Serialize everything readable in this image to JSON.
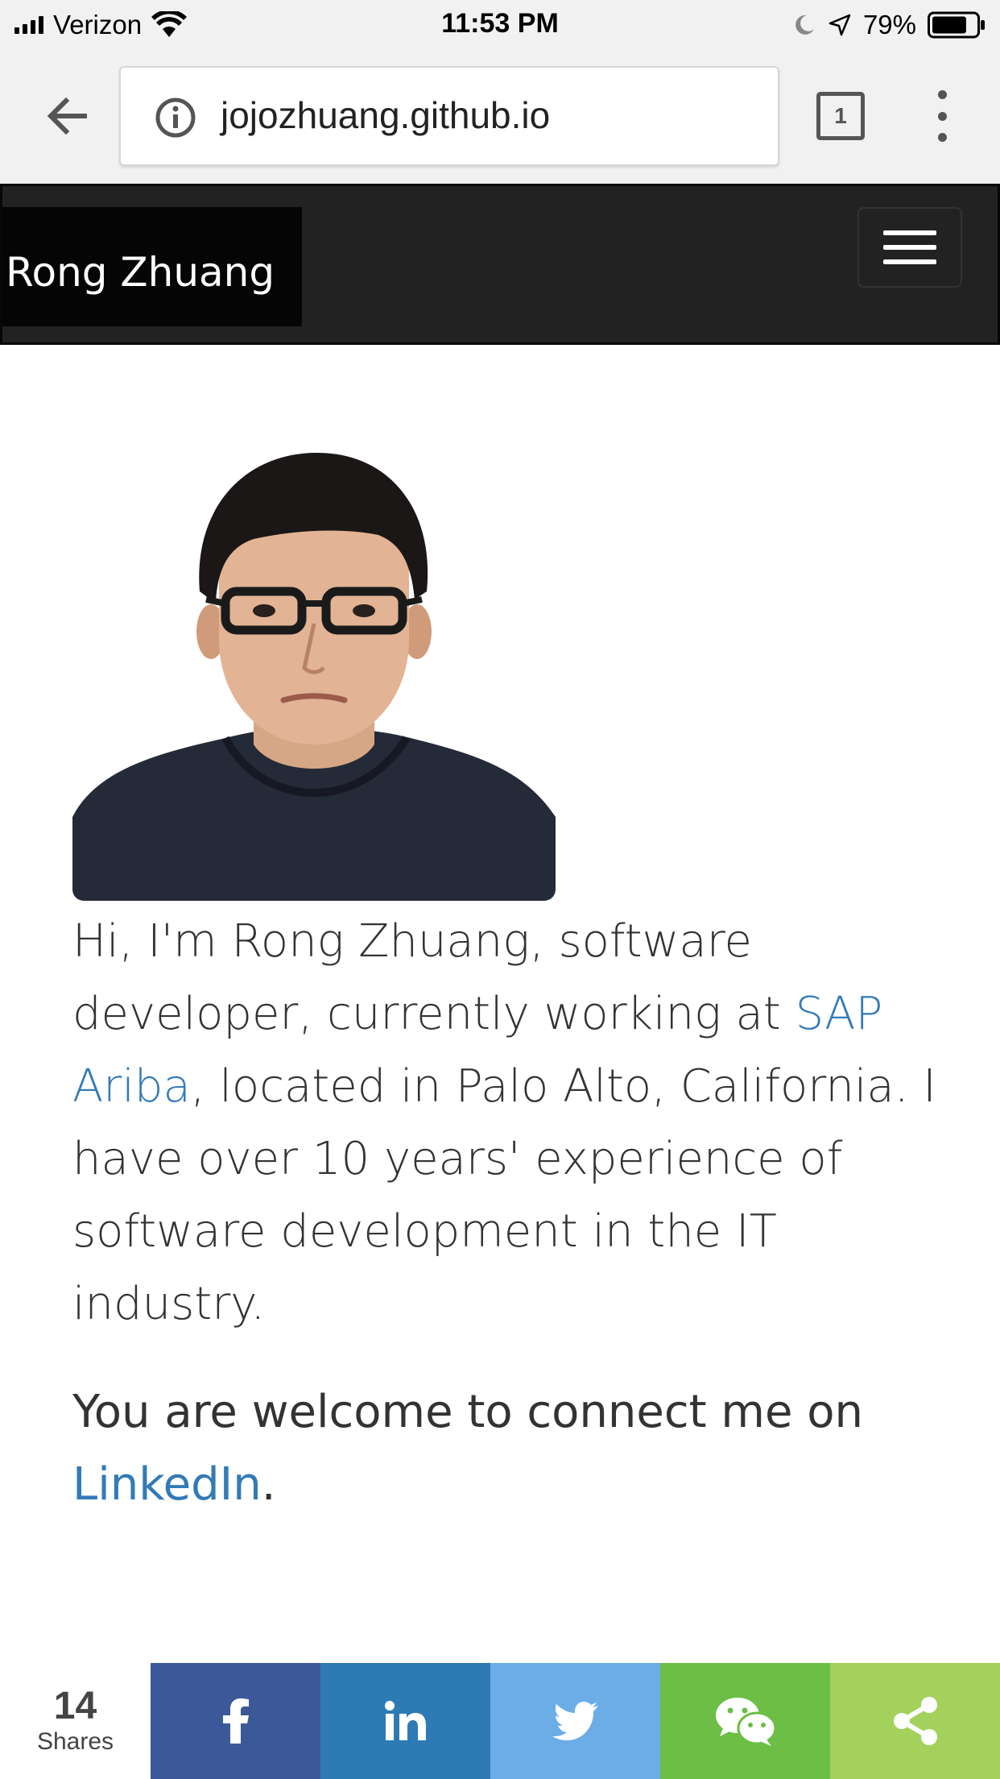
{
  "status_bar": {
    "carrier": "Verizon",
    "time": "11:53 PM",
    "battery_percent": "79%",
    "battery_level": 0.79
  },
  "browser": {
    "url": "jojozhuang.github.io",
    "tab_count": "1"
  },
  "navbar": {
    "brand": "Rong Zhuang"
  },
  "bio": {
    "intro": "Hi, I'm Rong Zhuang, software developer, currently working at ",
    "company_link": "SAP Ariba",
    "location": ", located in Palo Alto, California. I have over 10 years' experience of software development in the IT industry."
  },
  "connect": {
    "text": "You are welcome to connect me on ",
    "link": "LinkedIn",
    "period": "."
  },
  "share": {
    "count": "14",
    "label": "Shares",
    "buttons": [
      "facebook-icon",
      "linkedin-icon",
      "twitter-icon",
      "wechat-icon",
      "share-icon"
    ],
    "colors": {
      "facebook": "#3b5998",
      "linkedin": "#2e7ab5",
      "twitter": "#6cade8",
      "wechat": "#6cbe45",
      "share": "#a4d05c"
    }
  }
}
